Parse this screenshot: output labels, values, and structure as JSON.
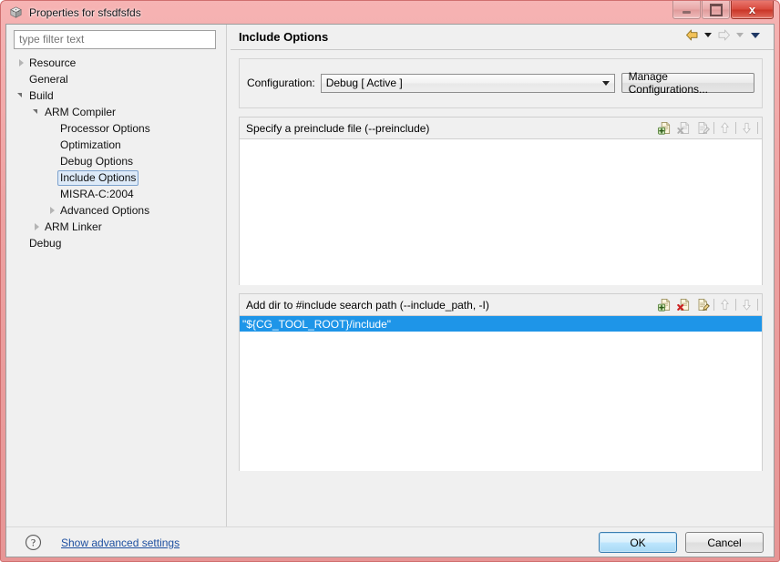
{
  "window": {
    "title": "Properties for sfsdfsfds",
    "icon": "cube-icon",
    "controls": {
      "minimize": "minimize-icon",
      "restore": "restore-icon",
      "close": "x"
    }
  },
  "left_pane": {
    "filter": {
      "placeholder": "type filter text",
      "value": ""
    },
    "tree": [
      {
        "label": "Resource",
        "indent": 0,
        "state": "collapsed",
        "selected": false
      },
      {
        "label": "General",
        "indent": 0,
        "state": "leaf",
        "selected": false
      },
      {
        "label": "Build",
        "indent": 0,
        "state": "expanded",
        "selected": false
      },
      {
        "label": "ARM Compiler",
        "indent": 1,
        "state": "expanded",
        "selected": false
      },
      {
        "label": "Processor Options",
        "indent": 2,
        "state": "leaf",
        "selected": false
      },
      {
        "label": "Optimization",
        "indent": 2,
        "state": "leaf",
        "selected": false
      },
      {
        "label": "Debug Options",
        "indent": 2,
        "state": "leaf",
        "selected": false
      },
      {
        "label": "Include Options",
        "indent": 2,
        "state": "leaf",
        "selected": true
      },
      {
        "label": "MISRA-C:2004",
        "indent": 2,
        "state": "leaf",
        "selected": false
      },
      {
        "label": "Advanced Options",
        "indent": 2,
        "state": "collapsed",
        "selected": false
      },
      {
        "label": "ARM Linker",
        "indent": 1,
        "state": "collapsed",
        "selected": false
      },
      {
        "label": "Debug",
        "indent": 0,
        "state": "leaf",
        "selected": false
      }
    ]
  },
  "right_pane": {
    "page_title": "Include Options",
    "nav": {
      "back_icon": "back-arrow-icon",
      "back_menu_icon": "chevron-down-icon",
      "forward_icon": "forward-arrow-icon",
      "forward_menu_icon": "chevron-down-icon",
      "page_menu_icon": "chevron-down-icon"
    },
    "configuration": {
      "label": "Configuration:",
      "selected": "Debug  [ Active ]",
      "options": [
        "Debug  [ Active ]"
      ],
      "manage_button": "Manage Configurations..."
    },
    "groups": [
      {
        "header": "Specify a preinclude file (--preinclude)",
        "items": [],
        "tools": [
          {
            "name": "add-icon",
            "enabled": true
          },
          {
            "name": "delete-icon",
            "enabled": false
          },
          {
            "name": "edit-icon",
            "enabled": false
          },
          {
            "name": "move-up-icon",
            "enabled": false
          },
          {
            "name": "move-down-icon",
            "enabled": false
          }
        ]
      },
      {
        "header": "Add dir to #include search path (--include_path, -I)",
        "items": [
          {
            "text": "\"${CG_TOOL_ROOT}/include\"",
            "selected": true
          }
        ],
        "tools": [
          {
            "name": "add-icon",
            "enabled": true
          },
          {
            "name": "delete-icon",
            "enabled": true
          },
          {
            "name": "edit-icon",
            "enabled": true
          },
          {
            "name": "move-up-icon",
            "enabled": false
          },
          {
            "name": "move-down-icon",
            "enabled": false
          }
        ]
      }
    ]
  },
  "bottom_bar": {
    "help_icon": "question-mark-icon",
    "advanced_link": "Show advanced settings",
    "ok_button": "OK",
    "cancel_button": "Cancel"
  },
  "colors": {
    "frame": "#eda0a0",
    "selection": "#1e95e8",
    "tree_selection": "#ddeaf8",
    "link": "#1d4fa0",
    "default_button": "#bee6fd"
  }
}
